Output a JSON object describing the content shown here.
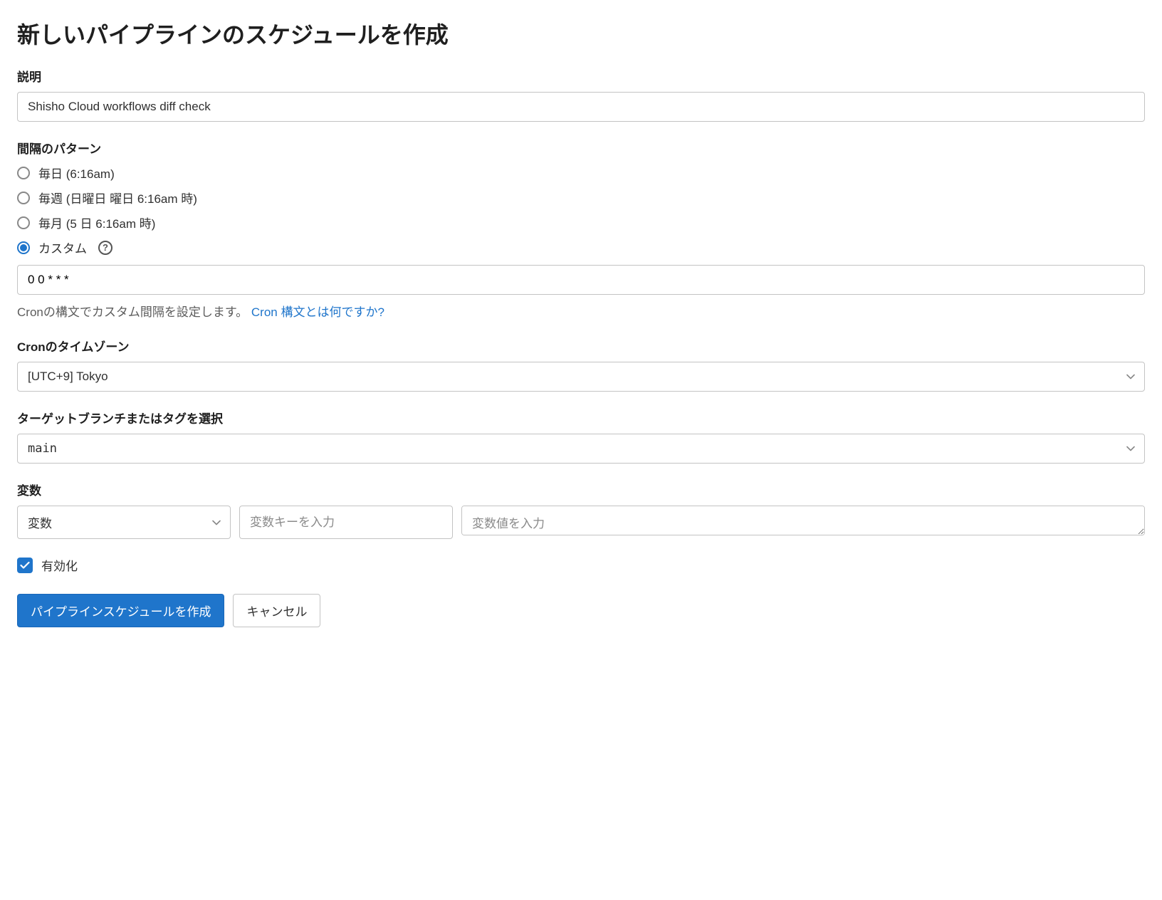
{
  "title": "新しいパイプラインのスケジュールを作成",
  "description": {
    "label": "説明",
    "value": "Shisho Cloud workflows diff check"
  },
  "interval": {
    "label": "間隔のパターン",
    "options": {
      "daily": "毎日 (6:16am)",
      "weekly": "毎週 (日曜日 曜日 6:16am 時)",
      "monthly": "毎月 (5 日 6:16am 時)",
      "custom": "カスタム"
    },
    "custom_value": "0 0 * * *",
    "hint_text": "Cronの構文でカスタム間隔を設定します。 ",
    "hint_link": "Cron 構文とは何ですか?"
  },
  "timezone": {
    "label": "Cronのタイムゾーン",
    "value": "[UTC+9] Tokyo"
  },
  "target": {
    "label": "ターゲットブランチまたはタグを選択",
    "value": "main"
  },
  "variables": {
    "label": "変数",
    "type_value": "変数",
    "key_placeholder": "変数キーを入力",
    "value_placeholder": "変数値を入力"
  },
  "enabled": {
    "label": "有効化"
  },
  "buttons": {
    "submit": "パイプラインスケジュールを作成",
    "cancel": "キャンセル"
  }
}
